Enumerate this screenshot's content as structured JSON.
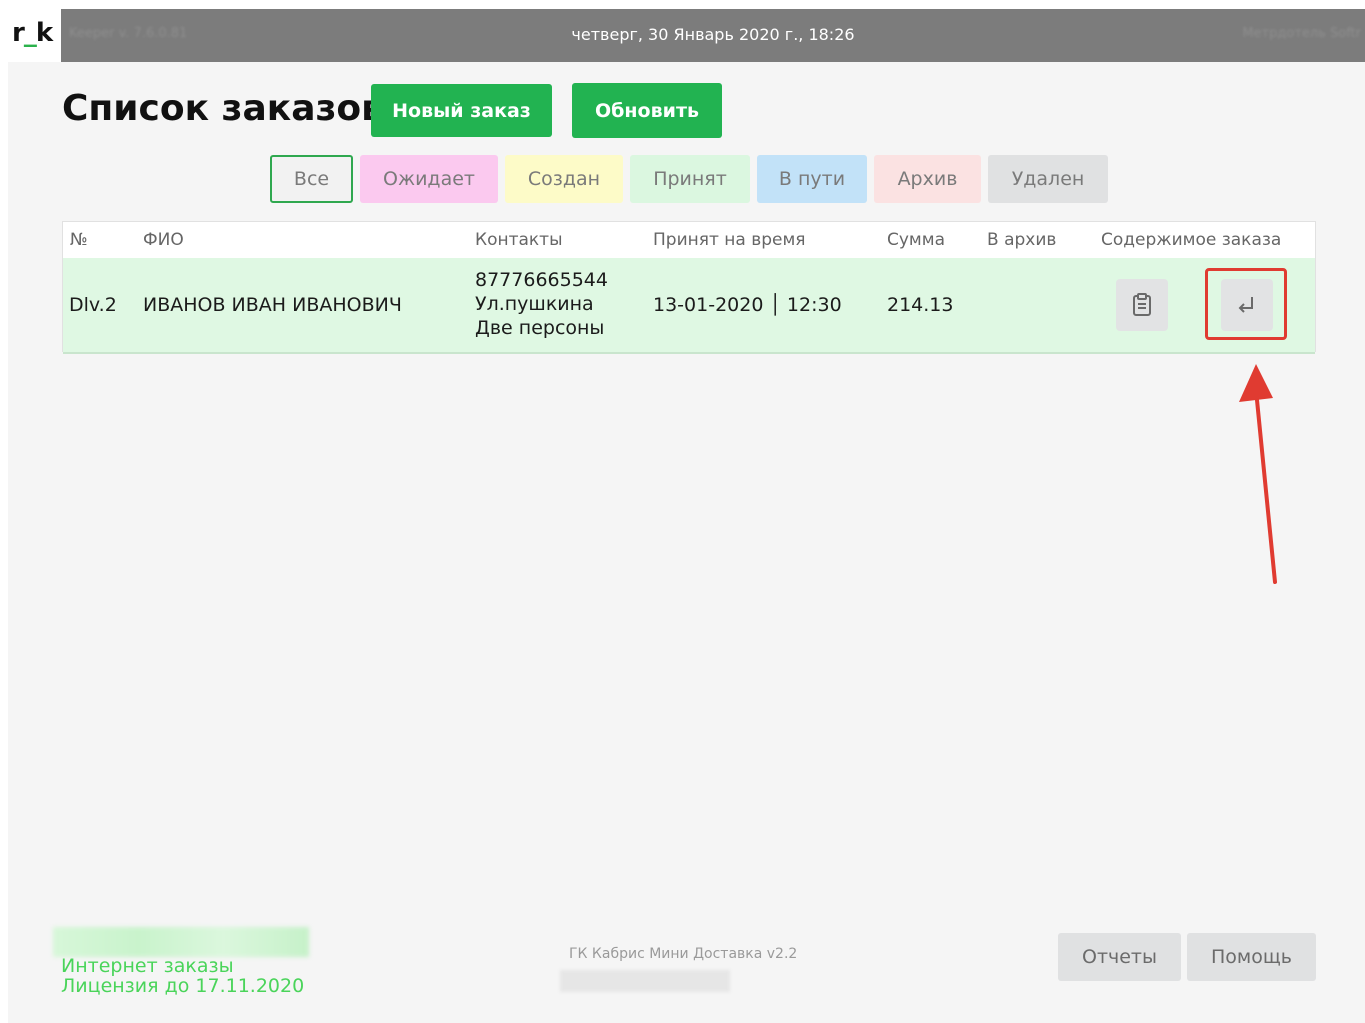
{
  "logo": {
    "left": "r",
    "mark": "_",
    "right": "k"
  },
  "topbar": {
    "version": "Keeper v. 7.6.0.81",
    "datetime": "четверг, 30 Январь 2020 г., 18:26",
    "right_text": "Метрдотель Softr"
  },
  "header": {
    "title": "Список заказов",
    "new_order_label": "Новый заказ",
    "refresh_label": "Обновить"
  },
  "filters": [
    {
      "label": "Все",
      "color": "#f2f2f2",
      "active": true
    },
    {
      "label": "Ожидает",
      "color": "#fbc9ef"
    },
    {
      "label": "Создан",
      "color": "#fdfbc8"
    },
    {
      "label": "Принят",
      "color": "#dbf7e0"
    },
    {
      "label": "В пути",
      "color": "#c2e2f8"
    },
    {
      "label": "Архив",
      "color": "#fbe2e2"
    },
    {
      "label": "Удален",
      "color": "#e0e1e2"
    }
  ],
  "table": {
    "headers": {
      "num": "№",
      "fio": "ФИО",
      "contacts": "Контакты",
      "time": "Принят на время",
      "sum": "Сумма",
      "archive": "В архив",
      "content": "Содержимое заказа"
    },
    "rows": [
      {
        "num": "Dlv.2",
        "fio": "ИВАНОВ ИВАН ИВАНОВИЧ",
        "phone": "87776665544",
        "address": "Ул.пушкина",
        "note": "Две персоны",
        "time": "13-01-2020 │ 12:30",
        "sum": "214.13"
      }
    ]
  },
  "footer": {
    "line1": "Интернет заказы",
    "line2": "Лицензия до 17.11.2020",
    "center": "ГК Кабрис Мини Доставка v2.2",
    "reports_label": "Отчеты",
    "help_label": "Помощь"
  },
  "colors": {
    "accent_green": "#22b351",
    "highlight_red": "#e03b31",
    "row_bg": "#dff8e3"
  },
  "icons": [
    "clipboard-icon",
    "return-arrow-icon",
    "annotation-arrow"
  ]
}
